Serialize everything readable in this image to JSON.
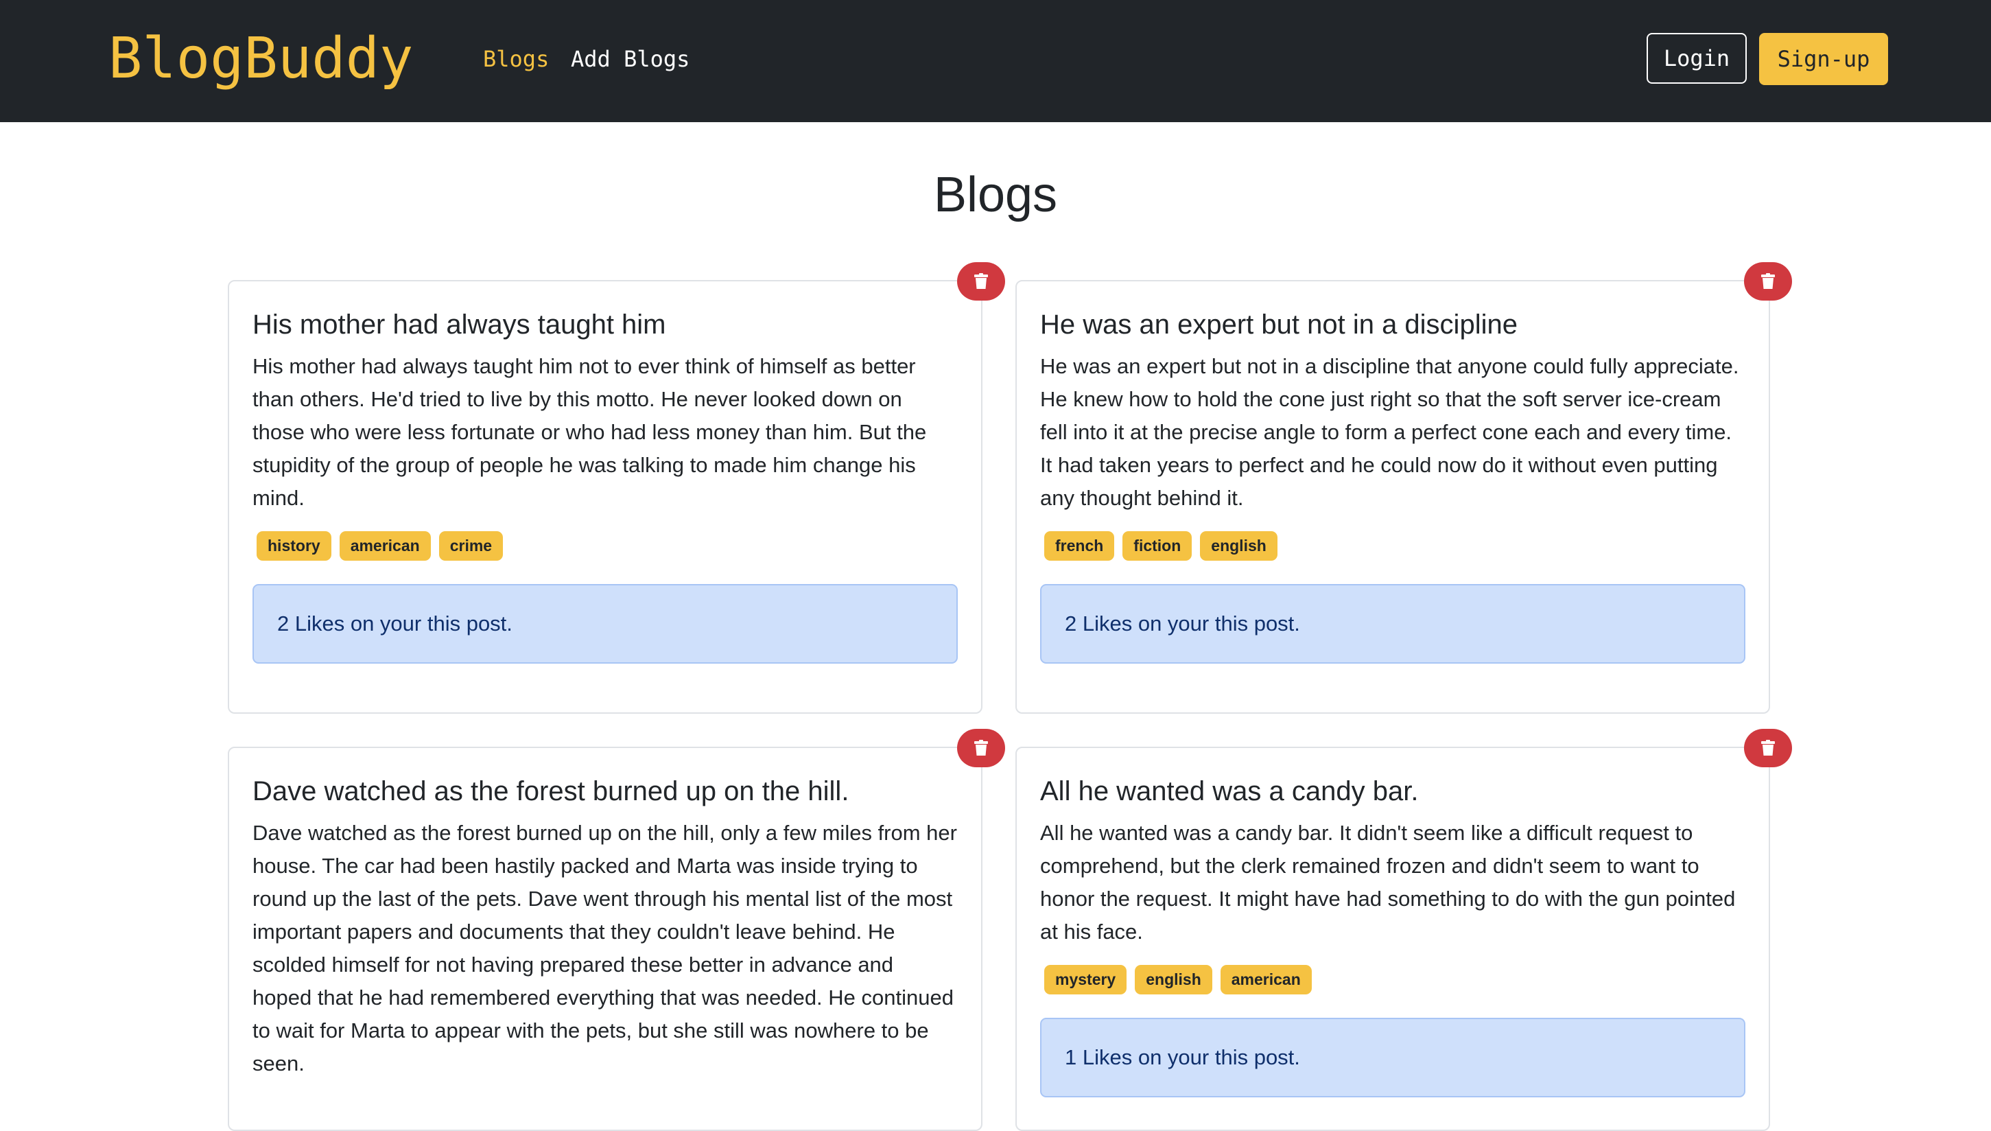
{
  "navbar": {
    "brand": "BlogBuddy",
    "links": [
      "Blogs",
      "Add Blogs"
    ],
    "login_label": "Login",
    "signup_label": "Sign-up"
  },
  "page": {
    "title": "Blogs"
  },
  "colors": {
    "navbar_bg": "#212529",
    "accent": "#f5c242",
    "delete": "#d0393f",
    "likes_bg": "#cfe0fb"
  },
  "icons": {
    "delete": "trash-icon"
  },
  "blogs": [
    {
      "title": "His mother had always taught him",
      "body": "His mother had always taught him not to ever think of himself as better than others. He'd tried to live by this motto. He never looked down on those who were less fortunate or who had less money than him. But the stupidity of the group of people he was talking to made him change his mind.",
      "tags": [
        "history",
        "american",
        "crime"
      ],
      "likes": "2 Likes on your this post."
    },
    {
      "title": "He was an expert but not in a discipline",
      "body": "He was an expert but not in a discipline that anyone could fully appreciate. He knew how to hold the cone just right so that the soft server ice-cream fell into it at the precise angle to form a perfect cone each and every time. It had taken years to perfect and he could now do it without even putting any thought behind it.",
      "tags": [
        "french",
        "fiction",
        "english"
      ],
      "likes": "2 Likes on your this post."
    },
    {
      "title": "Dave watched as the forest burned up on the hill.",
      "body": "Dave watched as the forest burned up on the hill, only a few miles from her house. The car had been hastily packed and Marta was inside trying to round up the last of the pets. Dave went through his mental list of the most important papers and documents that they couldn't leave behind. He scolded himself for not having prepared these better in advance and hoped that he had remembered everything that was needed. He continued to wait for Marta to appear with the pets, but she still was nowhere to be seen.",
      "tags": [],
      "likes": ""
    },
    {
      "title": "All he wanted was a candy bar.",
      "body": "All he wanted was a candy bar. It didn't seem like a difficult request to comprehend, but the clerk remained frozen and didn't seem to want to honor the request. It might have had something to do with the gun pointed at his face.",
      "tags": [
        "mystery",
        "english",
        "american"
      ],
      "likes": "1 Likes on your this post."
    }
  ]
}
